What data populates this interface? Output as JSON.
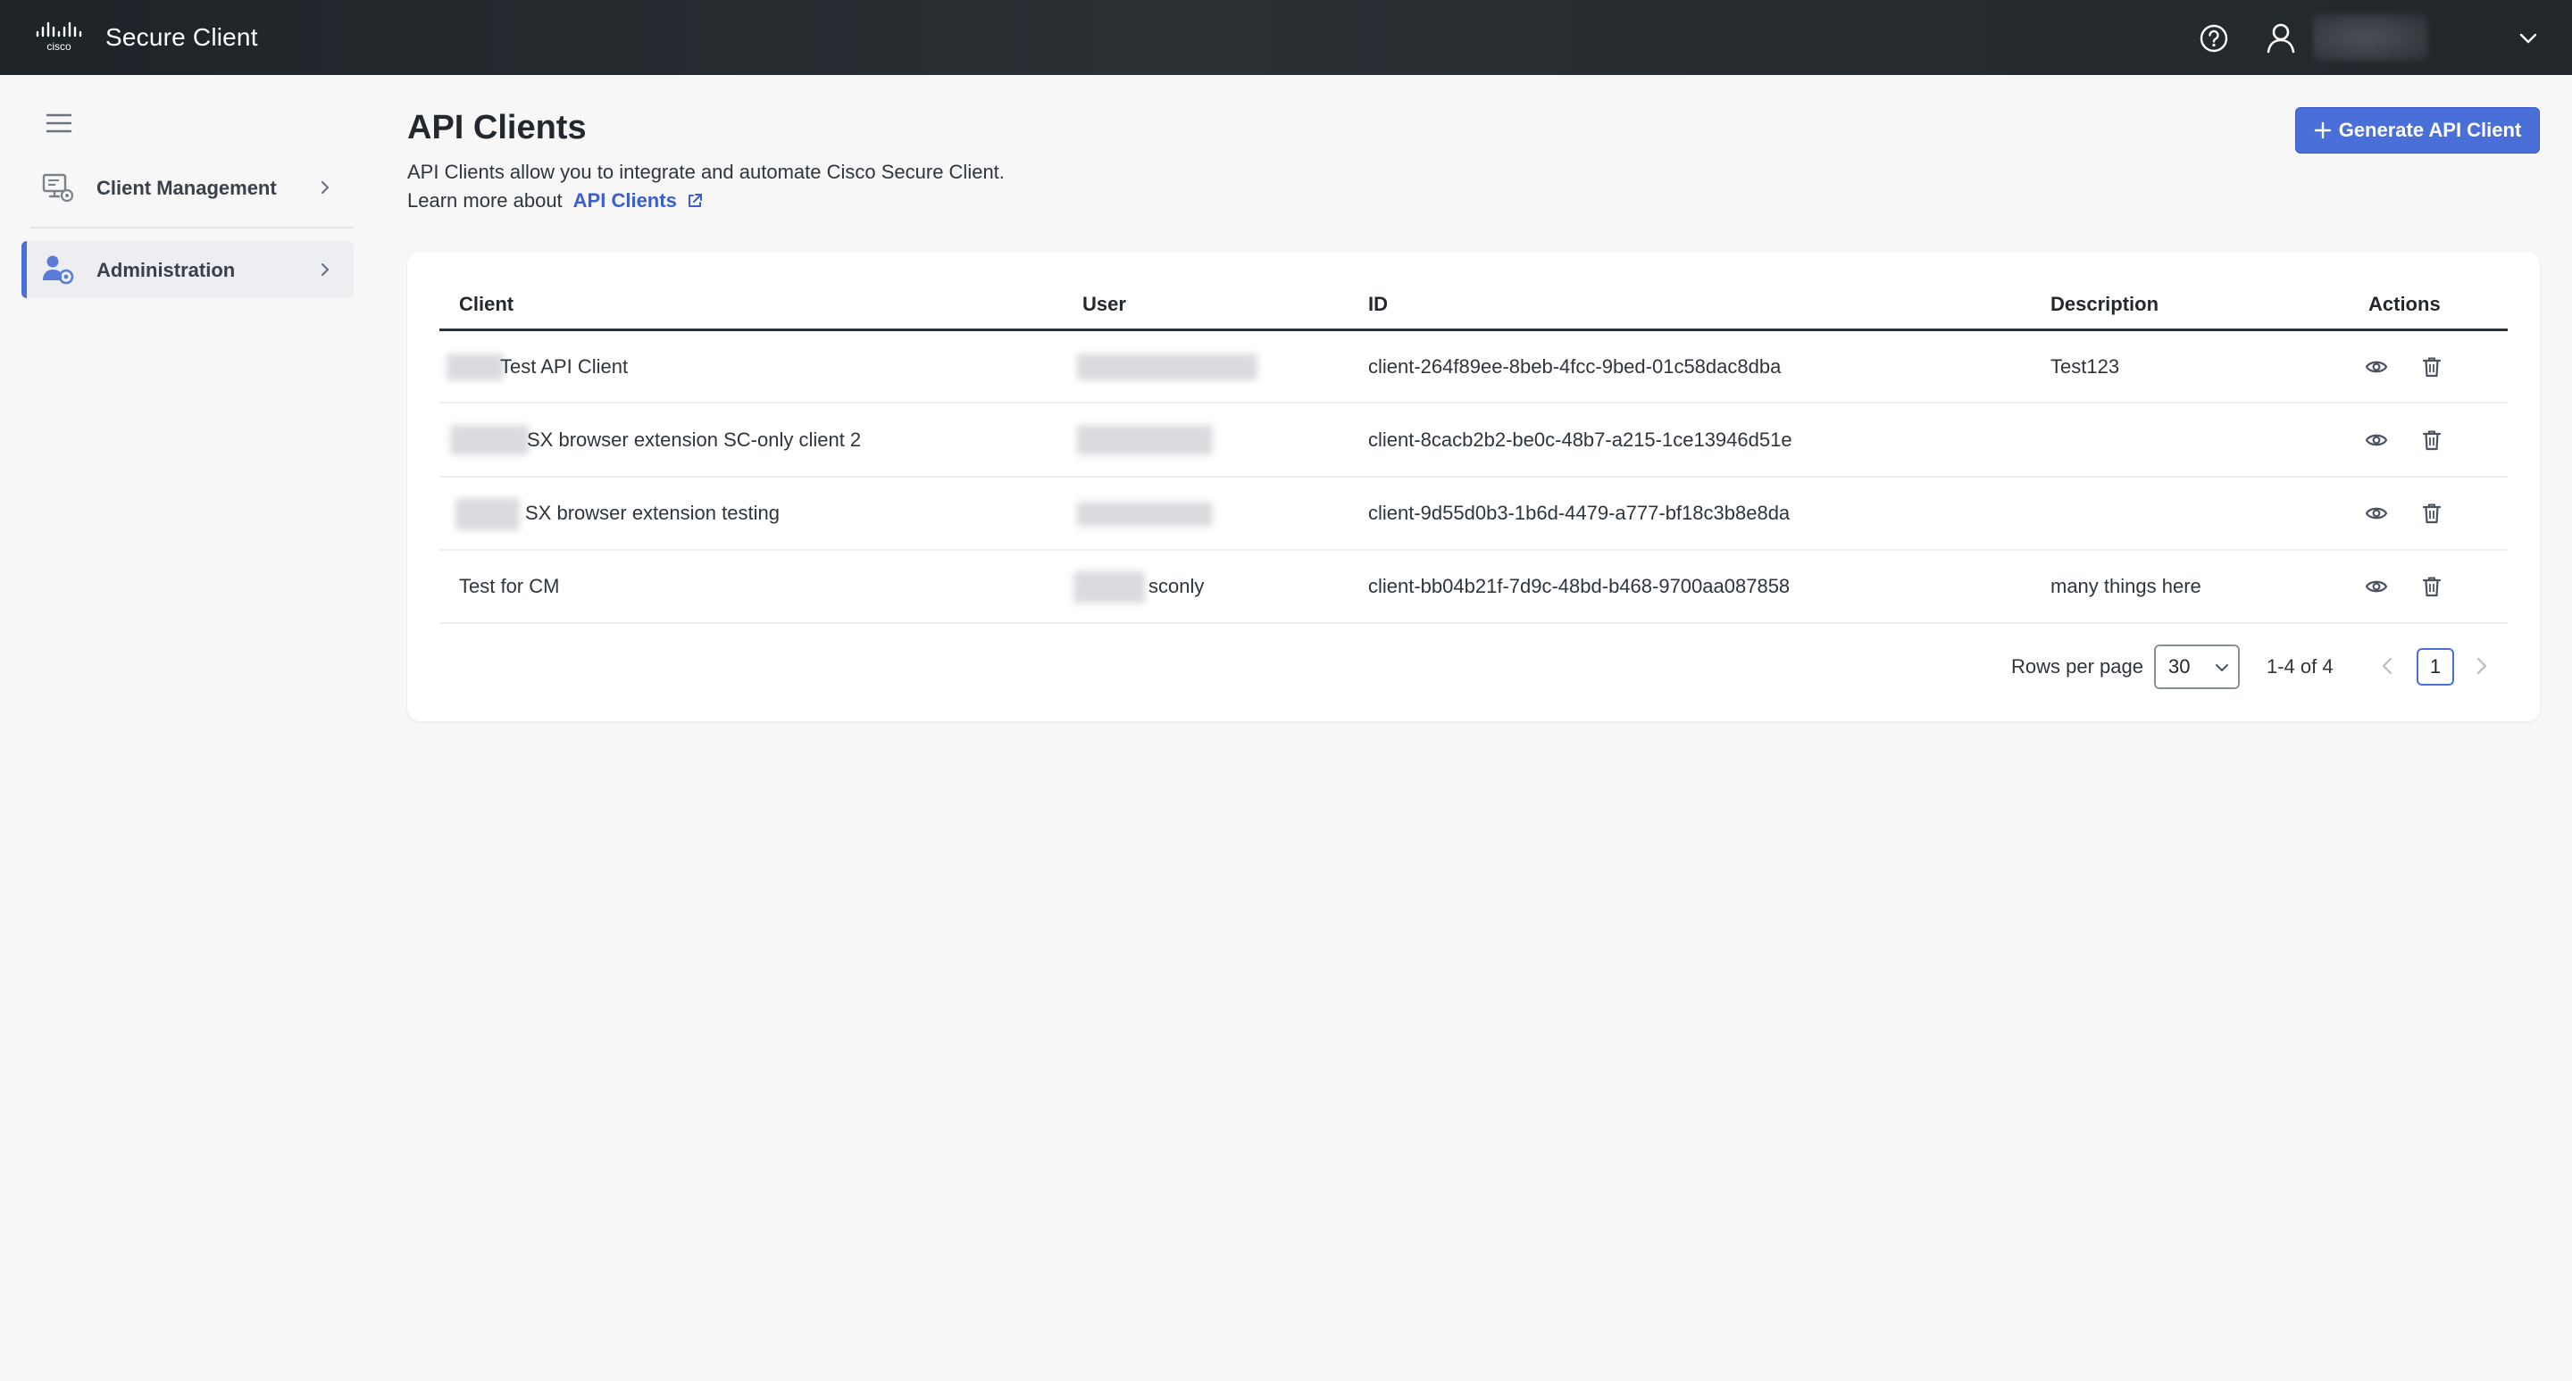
{
  "header": {
    "brand": "cisco",
    "app_title": "Secure Client"
  },
  "sidebar": {
    "items": [
      {
        "label": "Client Management",
        "icon": "client-management-icon"
      },
      {
        "label": "Administration",
        "icon": "administration-icon",
        "active": true
      }
    ]
  },
  "main": {
    "title": "API Clients",
    "description": "API Clients allow you to integrate and automate Cisco Secure Client.",
    "learn_prefix": "Learn more about",
    "learn_link": "API Clients",
    "generate_button": "Generate API Client"
  },
  "table": {
    "columns": [
      "Client",
      "User",
      "ID",
      "Description",
      "Actions"
    ],
    "rows": [
      {
        "client": "Test API Client",
        "user": "",
        "id": "client-264f89ee-8beb-4fcc-9bed-01c58dac8dba",
        "description": "Test123"
      },
      {
        "client": "SX browser extension SC-only client 2",
        "user": "",
        "id": "client-8cacb2b2-be0c-48b7-a215-1ce13946d51e",
        "description": ""
      },
      {
        "client": "SX browser extension testing",
        "user": "",
        "id": "client-9d55d0b3-1b6d-4479-a777-bf18c3b8e8da",
        "description": ""
      },
      {
        "client": "Test for CM",
        "user": "sconly",
        "id": "client-bb04b21f-7d9c-48bd-b468-9700aa087858",
        "description": "many things here"
      }
    ]
  },
  "pagination": {
    "rows_per_page_label": "Rows per page",
    "rows_per_page": "30",
    "range": "1-4 of 4",
    "current_page": "1"
  },
  "colors": {
    "accent": "#4a6fd8",
    "topbar": "#23272b",
    "background": "#f7f7f7"
  }
}
